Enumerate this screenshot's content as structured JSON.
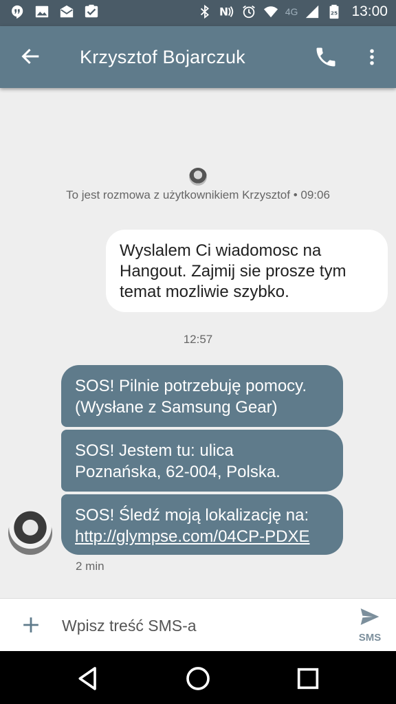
{
  "status_bar": {
    "time": "13:00",
    "network": "4G",
    "left_icons": [
      "hangouts-icon",
      "gallery-icon",
      "mail-icon",
      "task-icon"
    ],
    "right_icons": [
      "bluetooth-icon",
      "nfc-icon",
      "alarm-icon",
      "wifi-icon",
      "signal-icon",
      "battery-icon"
    ],
    "battery_label": "25"
  },
  "app_bar": {
    "title": "Krzysztof Bojarczuk",
    "icons": [
      "back-arrow-icon",
      "phone-icon",
      "more-vert-icon"
    ]
  },
  "conversation": {
    "intro_text": "To jest rozmowa z użytkownikiem Krzysztof • 09:06",
    "outgoing": {
      "line1": "Wyslalem Ci wiadomosc na",
      "line2": "Hangout. Zajmij sie prosze tym",
      "line3": "temat mozliwie szybko."
    },
    "time_divider": "12:57",
    "incoming": [
      {
        "line1": "SOS! Pilnie potrzebuję pomocy.",
        "line2": "(Wysłane z Samsung Gear)"
      },
      {
        "line1": "SOS! Jestem tu: ulica",
        "line2": "Poznańska, 62-004, Polska."
      },
      {
        "line1": "SOS! Śledź moją lokalizację na:",
        "line2": "http://glympse.com/04CP-PDXE"
      }
    ],
    "message_age": "2 min"
  },
  "compose": {
    "placeholder": "Wpisz treść SMS-a",
    "send_label": "SMS"
  },
  "nav_bar": {
    "icons": [
      "back-triangle-icon",
      "home-circle-icon",
      "recents-square-icon"
    ]
  },
  "colors": {
    "status_bar": "#4a5b67",
    "app_bar": "#5f7b8b",
    "incoming_bubble": "#5f7b8b",
    "outgoing_bubble": "#ffffff",
    "background": "#eeeeee"
  }
}
